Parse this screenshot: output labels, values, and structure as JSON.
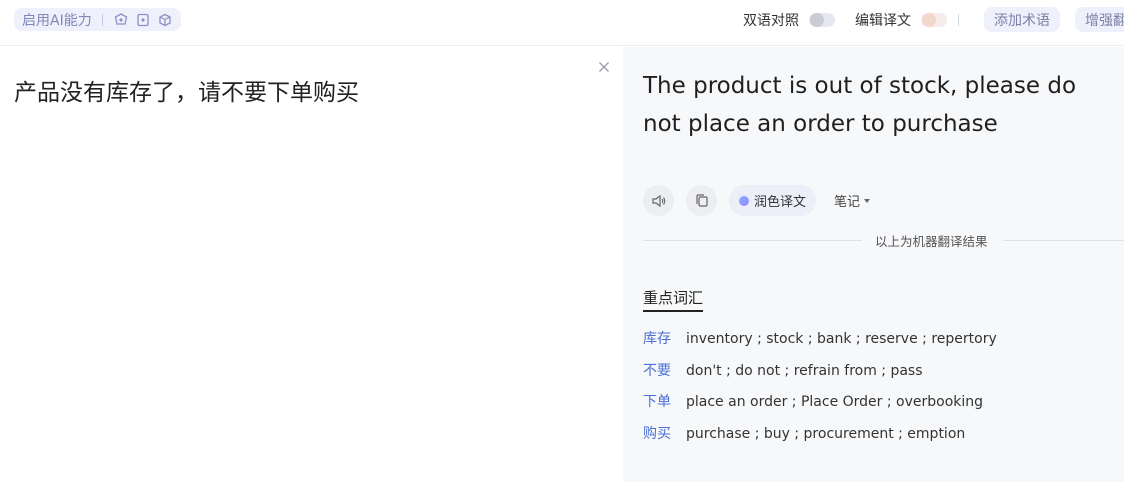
{
  "toolbar": {
    "ai_label": "启用AI能力",
    "icons": [
      "ai-refine-icon",
      "ai-doc-icon",
      "ai-cube-icon"
    ],
    "bilingual_label": "双语对照",
    "bilingual_on": false,
    "edit_label": "编辑译文",
    "edit_on": false,
    "add_term_label": "添加术语",
    "enhance_label": "增强翻"
  },
  "source": {
    "text": "产品没有库存了，请不要下单购买"
  },
  "translation": {
    "text": "The product is out of stock, please do not place an order to purchase",
    "polish_label": "润色译文",
    "notes_label": "笔记",
    "machine_notice": "以上为机器翻译结果"
  },
  "vocab": {
    "title": "重点词汇",
    "items": [
      {
        "term": "库存",
        "defs": "inventory ; stock ; bank ; reserve ; repertory"
      },
      {
        "term": "不要",
        "defs": "don't ; do not ; refrain from ; pass"
      },
      {
        "term": "下单",
        "defs": "place an order ; Place Order ; overbooking"
      },
      {
        "term": "购买",
        "defs": "purchase ; buy ; procurement ; emption"
      }
    ]
  },
  "colors": {
    "accent": "#4a6fd6",
    "pill_bg": "#eef0fb",
    "right_bg": "#f7f8fa"
  }
}
